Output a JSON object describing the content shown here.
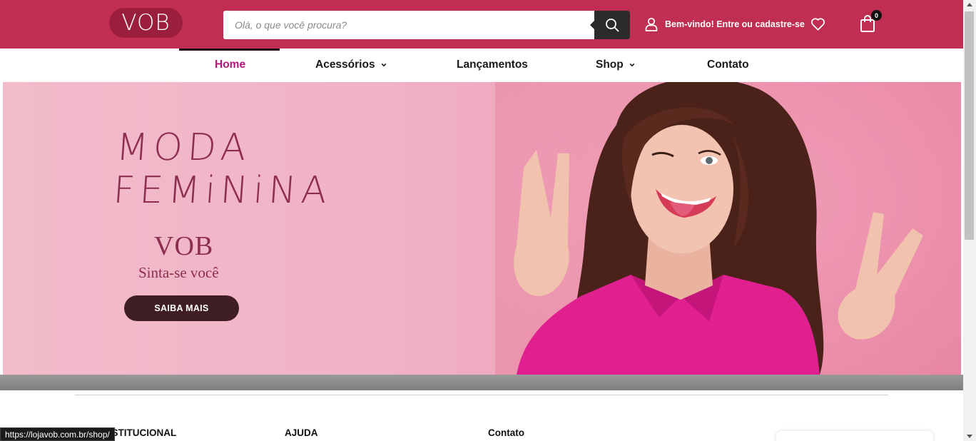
{
  "header": {
    "logo_text": "VOB",
    "search_placeholder": "Olá, o que você procura?",
    "account_label": "Bem-vindo! Entre ou cadastre-se",
    "cart_count": "0"
  },
  "nav": {
    "items": [
      {
        "label": "Home",
        "active": true
      },
      {
        "label": "Acessórios",
        "dropdown": true
      },
      {
        "label": "Lançamentos"
      },
      {
        "label": "Shop",
        "dropdown": true
      },
      {
        "label": "Contato"
      }
    ]
  },
  "banner": {
    "headline_line1": "MODA",
    "headline_line2": "FEMiNiNA",
    "brand": "VOB",
    "tagline": "Sinta-se você",
    "cta_label": "SAIBA MAIS"
  },
  "footer": {
    "col1": "INSTITUCIONAL",
    "col2": "AJUDA",
    "col3": "Contato"
  },
  "status_bar": {
    "url": "https://lojavob.com.br/shop/"
  },
  "colors": {
    "brand_red": "#c02e52",
    "active_nav": "#b5157a",
    "banner_pink": "#f0b2c5",
    "cta_dark": "#3f1f24"
  }
}
